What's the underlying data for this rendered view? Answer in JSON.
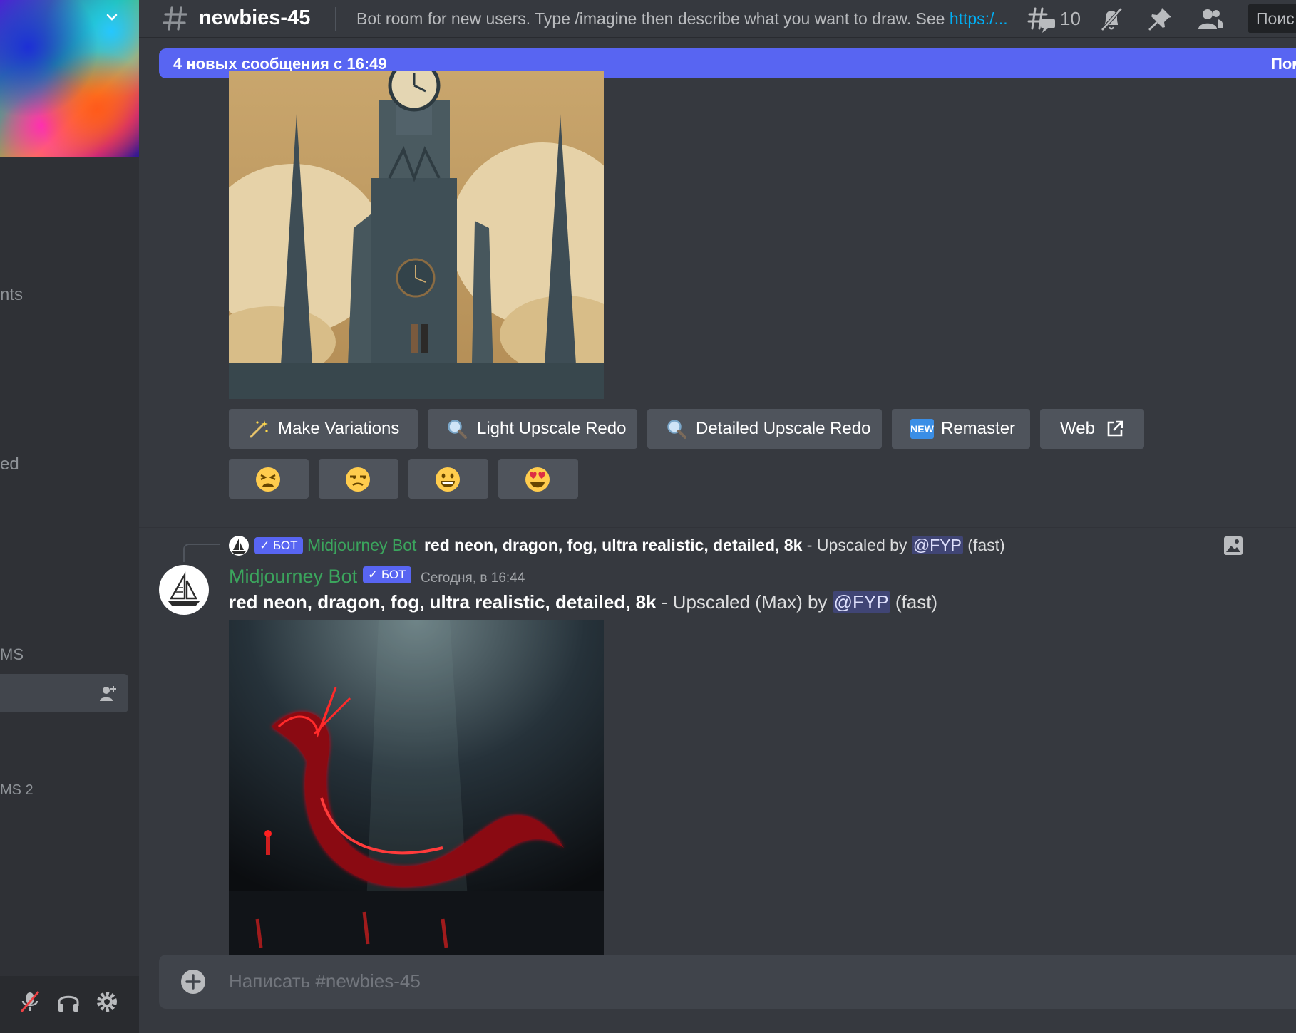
{
  "sidebar": {
    "fragments": [
      "nts",
      "ed",
      "MS",
      "MS 2"
    ]
  },
  "header": {
    "channel_name": "newbies-45",
    "topic_text": "Bot room for new users. Type /imagine then describe what you want to draw. See ",
    "topic_link": "https:/...",
    "threads_count": "10",
    "search_placeholder": "Поис"
  },
  "new_messages": {
    "label": "4 новых сообщения с 16:49",
    "action": "Пом"
  },
  "upscale_buttons": [
    {
      "label": "Make Variations",
      "icon": "magic-wand-icon"
    },
    {
      "label": "Light Upscale Redo",
      "icon": "magnifier-icon"
    },
    {
      "label": "Detailed Upscale Redo",
      "icon": "magnifier-icon"
    },
    {
      "label": "Remaster",
      "icon": "new-badge-icon",
      "icon_text": "NEW"
    },
    {
      "label": "Web",
      "icon": "external-link-icon"
    }
  ],
  "reactions": [
    "tired-face-icon",
    "unamused-face-icon",
    "grinning-face-icon",
    "heart-eyes-face-icon"
  ],
  "reply": {
    "bot_tag": "✓ БОТ",
    "author": "Midjourney Bot",
    "prompt": "red neon, dragon, fog, ultra realistic, detailed, 8k",
    "middle": " - Upscaled by ",
    "mention": "@FYP",
    "speed": " (fast)"
  },
  "message": {
    "author": "Midjourney Bot",
    "bot_tag": "✓ БОТ",
    "timestamp": "Сегодня, в 16:44",
    "prompt": "red neon, dragon, fog, ultra realistic, detailed, 8k",
    "middle": " - Upscaled (Max) by ",
    "mention": "@FYP",
    "speed": " (fast)"
  },
  "composer": {
    "placeholder": "Написать #newbies-45"
  },
  "colors": {
    "background": "#36393f",
    "sidebar": "#2f3136",
    "accent": "#5865f2",
    "bot_green": "#3ba55d",
    "link": "#00aff4",
    "button": "#4f545c"
  }
}
